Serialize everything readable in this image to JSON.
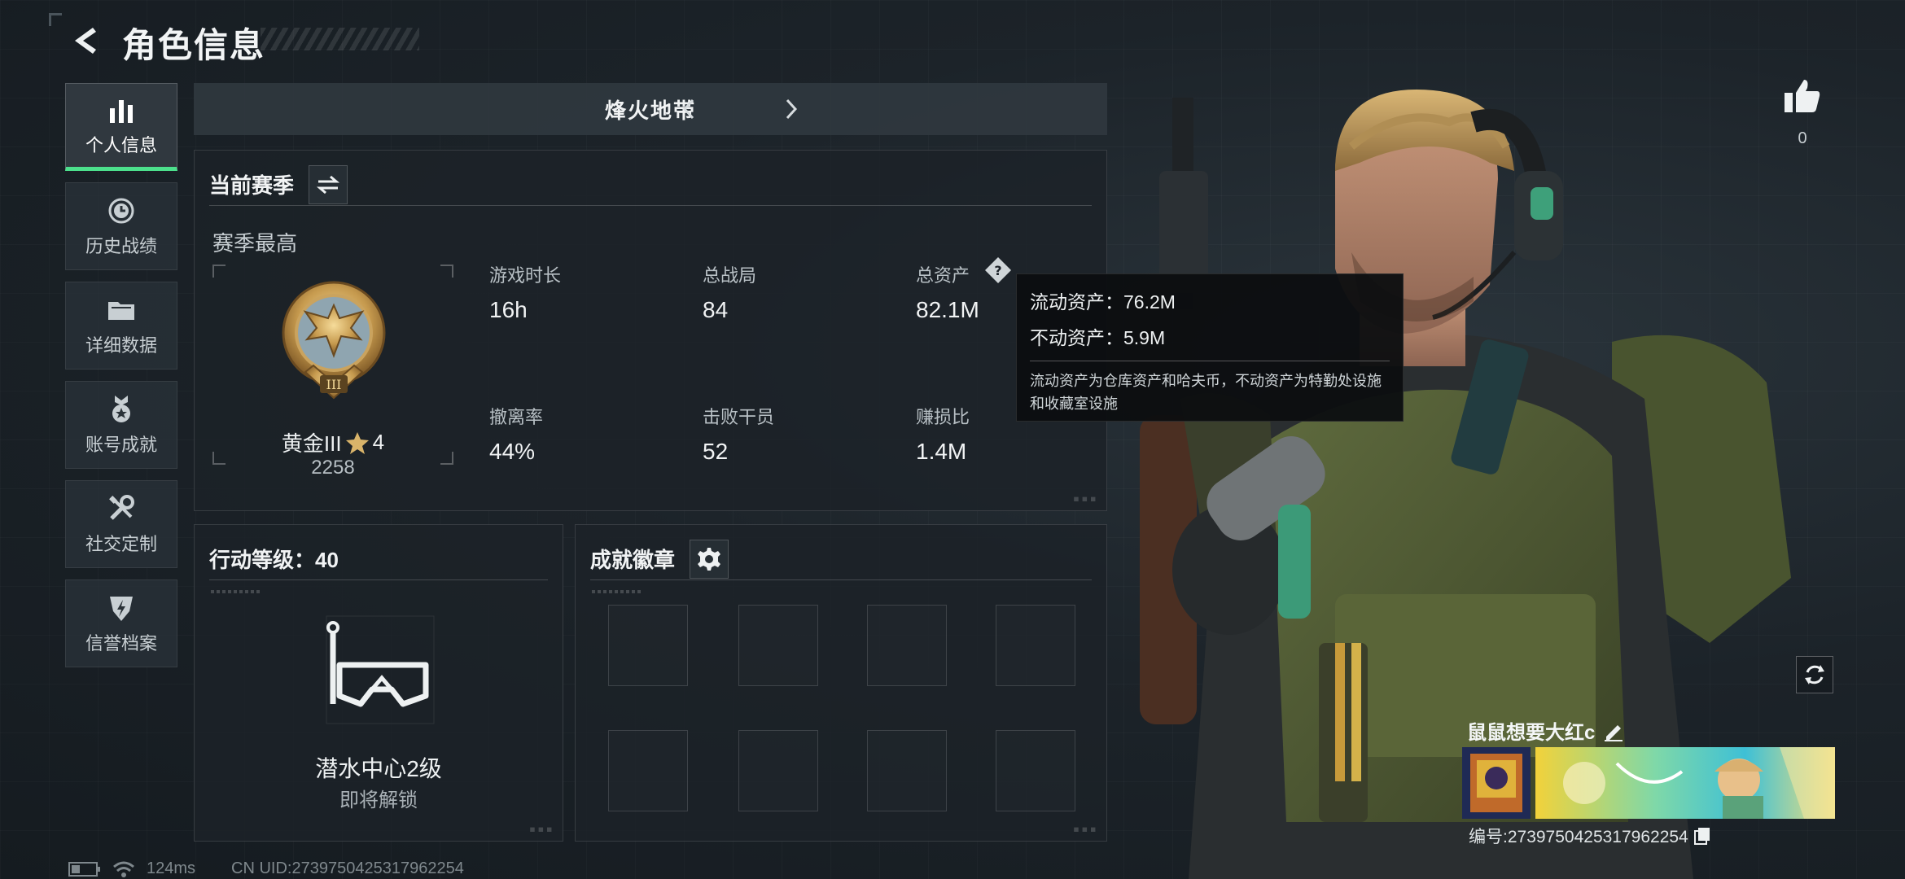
{
  "header": {
    "title": "角色信息"
  },
  "nav": {
    "items": [
      {
        "label": "个人信息",
        "icon": "bar-chart-icon",
        "active": true
      },
      {
        "label": "历史战绩",
        "icon": "history-icon"
      },
      {
        "label": "详细数据",
        "icon": "folder-icon"
      },
      {
        "label": "账号成就",
        "icon": "medal-icon"
      },
      {
        "label": "社交定制",
        "icon": "tools-icon"
      },
      {
        "label": "信誉档案",
        "icon": "shield-bolt-icon"
      }
    ]
  },
  "mode": {
    "title": "烽火地带",
    "prev_icon": "chevron-left-icon",
    "next_icon": "chevron-right-icon"
  },
  "season": {
    "heading": "当前赛季",
    "subheading": "赛季最高",
    "rank_name": "黄金III",
    "rank_stars": "4",
    "rank_score": "2258",
    "stats": [
      {
        "label": "游戏时长",
        "value": "16h"
      },
      {
        "label": "总战局",
        "value": "84"
      },
      {
        "label": "总资产",
        "value": "82.1M"
      },
      {
        "label": "撤离率",
        "value": "44%"
      },
      {
        "label": "击败干员",
        "value": "52"
      },
      {
        "label": "赚损比",
        "value": "1.4M"
      }
    ]
  },
  "tooltip": {
    "liquid": "流动资产：76.2M",
    "fixed": "不动资产：5.9M",
    "desc": "流动资产为仓库资产和哈夫币，不动资产为特勤处设施和收藏室设施"
  },
  "level": {
    "heading": "行动等级：40",
    "unlock_name": "潜水中心2级",
    "unlock_status": "即将解锁"
  },
  "badges": {
    "heading": "成就徽章",
    "slots": 8
  },
  "footer": {
    "ping": "124ms",
    "uid": "CN UID:2739750425317962254"
  },
  "profile": {
    "likes": "0",
    "player_name": "鼠鼠想要大红c",
    "player_id": "编号:2739750425317962254"
  },
  "colors": {
    "accent": "#4ce08c",
    "panel": "#1c2228",
    "text": "#eef1f2"
  }
}
